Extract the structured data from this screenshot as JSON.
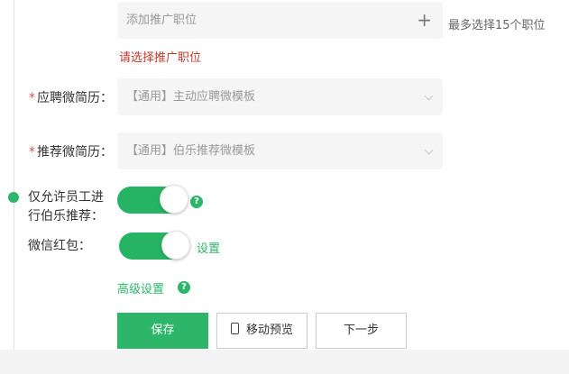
{
  "positions": {
    "placeholder": "添加推广职位",
    "plus_symbol": "+",
    "max_hint": "最多选择15个职位",
    "error": "请选择推广职位"
  },
  "resume_template": {
    "required_mark": "*",
    "label": "应聘微简历：",
    "value": "【通用】主动应聘微模板"
  },
  "recommend_template": {
    "required_mark": "*",
    "label": "推荐微简历：",
    "value": "【通用】伯乐推荐微模板"
  },
  "employee_only": {
    "label": "仅允许员工进行伯乐推荐：",
    "enabled": true,
    "help_symbol": "?"
  },
  "wechat_hongbao": {
    "label": "微信红包：",
    "enabled": true,
    "settings_link": "设置"
  },
  "advanced": {
    "label": "高级设置",
    "help_symbol": "?"
  },
  "buttons": {
    "save": "保存",
    "preview": "移动预览",
    "next": "下一步"
  },
  "icons": {
    "plus": "plus-icon",
    "chevron": "chevron-down-icon",
    "help": "help-icon",
    "phone": "phone-icon"
  },
  "colors": {
    "accent": "#2db669",
    "error": "#c0392b",
    "field_bg": "#f5f5f5"
  }
}
